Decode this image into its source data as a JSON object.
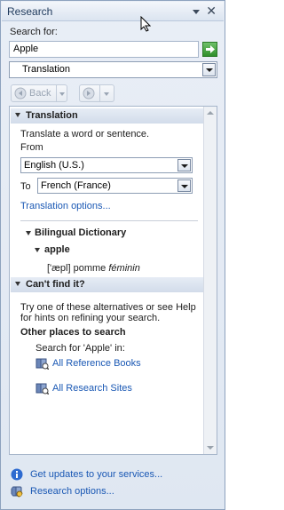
{
  "window": {
    "title": "Research"
  },
  "search": {
    "label": "Search for:",
    "value": "Apple"
  },
  "source": {
    "selected": "Translation"
  },
  "nav": {
    "back_label": "Back"
  },
  "translation": {
    "header": "Translation",
    "intro": "Translate a word or sentence.",
    "from_label": "From",
    "from_value": "English (U.S.)",
    "to_label": "To",
    "to_value": "French (France)",
    "options_link": "Translation options..."
  },
  "dictionary": {
    "title": "Bilingual Dictionary",
    "word": "apple",
    "pronunciation": "['æpl] pomme",
    "gender": "féminin"
  },
  "cant_find": {
    "header": "Can't find it?",
    "text_line1": "Try one of these alternatives or see Help",
    "text_line2": "for hints on refining your search.",
    "other_places": "Other places to search",
    "search_for": "Search for 'Apple' in:",
    "all_reference_books": "All Reference Books",
    "all_research_sites": "All Research Sites"
  },
  "footer": {
    "updates_link": "Get updates to your services...",
    "options_link": "Research options..."
  }
}
